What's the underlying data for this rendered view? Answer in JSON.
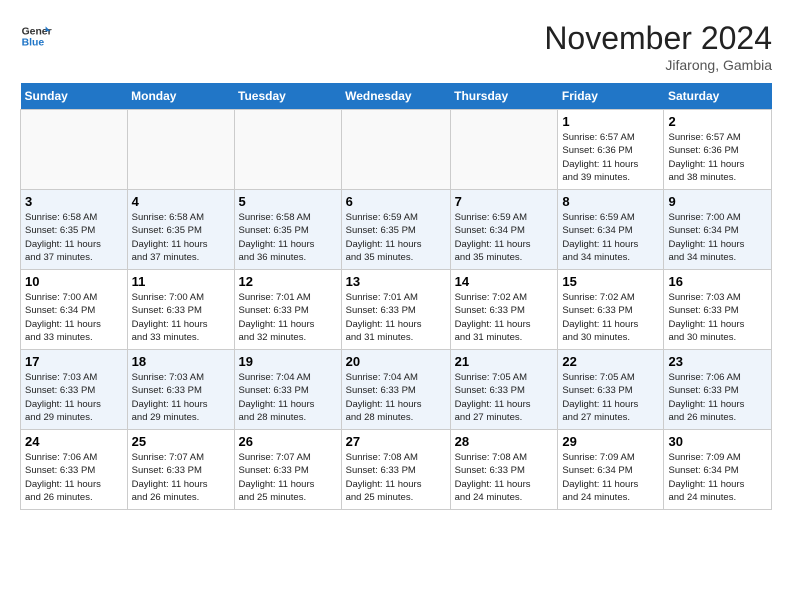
{
  "header": {
    "logo_line1": "General",
    "logo_line2": "Blue",
    "month": "November 2024",
    "location": "Jifarong, Gambia"
  },
  "weekdays": [
    "Sunday",
    "Monday",
    "Tuesday",
    "Wednesday",
    "Thursday",
    "Friday",
    "Saturday"
  ],
  "weeks": [
    [
      {
        "day": "",
        "info": ""
      },
      {
        "day": "",
        "info": ""
      },
      {
        "day": "",
        "info": ""
      },
      {
        "day": "",
        "info": ""
      },
      {
        "day": "",
        "info": ""
      },
      {
        "day": "1",
        "info": "Sunrise: 6:57 AM\nSunset: 6:36 PM\nDaylight: 11 hours\nand 39 minutes."
      },
      {
        "day": "2",
        "info": "Sunrise: 6:57 AM\nSunset: 6:36 PM\nDaylight: 11 hours\nand 38 minutes."
      }
    ],
    [
      {
        "day": "3",
        "info": "Sunrise: 6:58 AM\nSunset: 6:35 PM\nDaylight: 11 hours\nand 37 minutes."
      },
      {
        "day": "4",
        "info": "Sunrise: 6:58 AM\nSunset: 6:35 PM\nDaylight: 11 hours\nand 37 minutes."
      },
      {
        "day": "5",
        "info": "Sunrise: 6:58 AM\nSunset: 6:35 PM\nDaylight: 11 hours\nand 36 minutes."
      },
      {
        "day": "6",
        "info": "Sunrise: 6:59 AM\nSunset: 6:35 PM\nDaylight: 11 hours\nand 35 minutes."
      },
      {
        "day": "7",
        "info": "Sunrise: 6:59 AM\nSunset: 6:34 PM\nDaylight: 11 hours\nand 35 minutes."
      },
      {
        "day": "8",
        "info": "Sunrise: 6:59 AM\nSunset: 6:34 PM\nDaylight: 11 hours\nand 34 minutes."
      },
      {
        "day": "9",
        "info": "Sunrise: 7:00 AM\nSunset: 6:34 PM\nDaylight: 11 hours\nand 34 minutes."
      }
    ],
    [
      {
        "day": "10",
        "info": "Sunrise: 7:00 AM\nSunset: 6:34 PM\nDaylight: 11 hours\nand 33 minutes."
      },
      {
        "day": "11",
        "info": "Sunrise: 7:00 AM\nSunset: 6:33 PM\nDaylight: 11 hours\nand 33 minutes."
      },
      {
        "day": "12",
        "info": "Sunrise: 7:01 AM\nSunset: 6:33 PM\nDaylight: 11 hours\nand 32 minutes."
      },
      {
        "day": "13",
        "info": "Sunrise: 7:01 AM\nSunset: 6:33 PM\nDaylight: 11 hours\nand 31 minutes."
      },
      {
        "day": "14",
        "info": "Sunrise: 7:02 AM\nSunset: 6:33 PM\nDaylight: 11 hours\nand 31 minutes."
      },
      {
        "day": "15",
        "info": "Sunrise: 7:02 AM\nSunset: 6:33 PM\nDaylight: 11 hours\nand 30 minutes."
      },
      {
        "day": "16",
        "info": "Sunrise: 7:03 AM\nSunset: 6:33 PM\nDaylight: 11 hours\nand 30 minutes."
      }
    ],
    [
      {
        "day": "17",
        "info": "Sunrise: 7:03 AM\nSunset: 6:33 PM\nDaylight: 11 hours\nand 29 minutes."
      },
      {
        "day": "18",
        "info": "Sunrise: 7:03 AM\nSunset: 6:33 PM\nDaylight: 11 hours\nand 29 minutes."
      },
      {
        "day": "19",
        "info": "Sunrise: 7:04 AM\nSunset: 6:33 PM\nDaylight: 11 hours\nand 28 minutes."
      },
      {
        "day": "20",
        "info": "Sunrise: 7:04 AM\nSunset: 6:33 PM\nDaylight: 11 hours\nand 28 minutes."
      },
      {
        "day": "21",
        "info": "Sunrise: 7:05 AM\nSunset: 6:33 PM\nDaylight: 11 hours\nand 27 minutes."
      },
      {
        "day": "22",
        "info": "Sunrise: 7:05 AM\nSunset: 6:33 PM\nDaylight: 11 hours\nand 27 minutes."
      },
      {
        "day": "23",
        "info": "Sunrise: 7:06 AM\nSunset: 6:33 PM\nDaylight: 11 hours\nand 26 minutes."
      }
    ],
    [
      {
        "day": "24",
        "info": "Sunrise: 7:06 AM\nSunset: 6:33 PM\nDaylight: 11 hours\nand 26 minutes."
      },
      {
        "day": "25",
        "info": "Sunrise: 7:07 AM\nSunset: 6:33 PM\nDaylight: 11 hours\nand 26 minutes."
      },
      {
        "day": "26",
        "info": "Sunrise: 7:07 AM\nSunset: 6:33 PM\nDaylight: 11 hours\nand 25 minutes."
      },
      {
        "day": "27",
        "info": "Sunrise: 7:08 AM\nSunset: 6:33 PM\nDaylight: 11 hours\nand 25 minutes."
      },
      {
        "day": "28",
        "info": "Sunrise: 7:08 AM\nSunset: 6:33 PM\nDaylight: 11 hours\nand 24 minutes."
      },
      {
        "day": "29",
        "info": "Sunrise: 7:09 AM\nSunset: 6:34 PM\nDaylight: 11 hours\nand 24 minutes."
      },
      {
        "day": "30",
        "info": "Sunrise: 7:09 AM\nSunset: 6:34 PM\nDaylight: 11 hours\nand 24 minutes."
      }
    ]
  ]
}
